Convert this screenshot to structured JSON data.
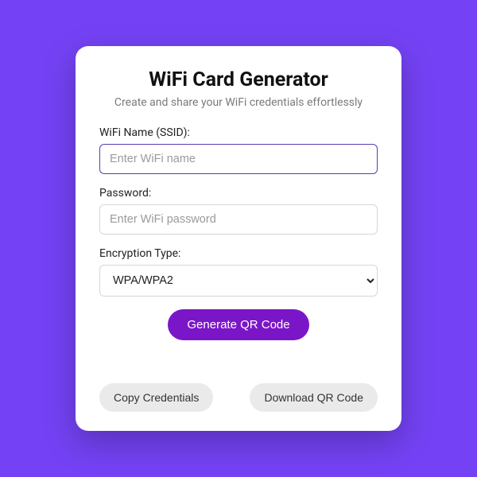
{
  "colors": {
    "page_bg": "#7442f4",
    "primary_btn": "#7b16c8",
    "secondary_btn": "#eaeaea",
    "focus_border": "#5b3bb5"
  },
  "header": {
    "title": "WiFi Card Generator",
    "subtitle": "Create and share your WiFi credentials effortlessly"
  },
  "form": {
    "ssid": {
      "label": "WiFi Name (SSID):",
      "placeholder": "Enter WiFi name",
      "value": ""
    },
    "password": {
      "label": "Password:",
      "placeholder": "Enter WiFi password",
      "value": ""
    },
    "encryption": {
      "label": "Encryption Type:",
      "selected": "WPA/WPA2"
    }
  },
  "buttons": {
    "generate": "Generate QR Code",
    "copy": "Copy Credentials",
    "download": "Download QR Code"
  }
}
